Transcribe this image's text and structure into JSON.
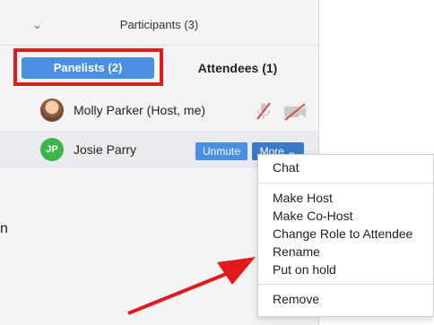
{
  "panel": {
    "title": "Participants (3)",
    "collapse_glyph": "⌄"
  },
  "tabs": {
    "panelists": "Panelists (2)",
    "attendees": "Attendees (1)"
  },
  "participants": [
    {
      "name": "Molly Parker (Host, me)",
      "avatar": "photo",
      "mic": "mic-muted-icon",
      "video": "video-off-icon"
    },
    {
      "name": "Josie Parry",
      "initials": "JP",
      "avatar_color": "#3cb54a"
    }
  ],
  "actions": {
    "unmute": "Unmute",
    "more": "More",
    "more_glyph": "⌄"
  },
  "menu": {
    "chat": "Chat",
    "make_host": "Make Host",
    "make_cohost": "Make Co-Host",
    "change_role": "Change Role to Attendee",
    "rename": "Rename",
    "put_on_hold": "Put on hold",
    "remove": "Remove"
  },
  "side_fragment": "n",
  "colors": {
    "tab_active": "#4a8fe0",
    "highlight": "#e11b1b",
    "arrow": "#e11b1b"
  }
}
